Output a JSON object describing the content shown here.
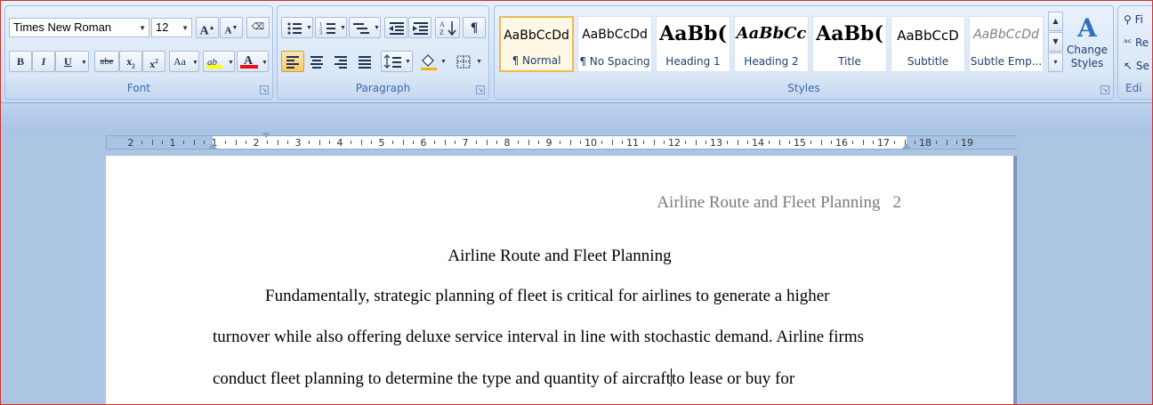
{
  "ribbon": {
    "font_group": {
      "label": "Font",
      "font_name": "Times New Roman",
      "font_size": "12",
      "grow_font": "A",
      "shrink_font": "A",
      "bold": "B",
      "italic": "I",
      "underline": "U",
      "strikethrough": "abe",
      "subscript": "x",
      "superscript": "x",
      "change_case": "Aa",
      "highlight_sample": "ab",
      "font_color_sample": "A",
      "highlight_color": "#ffff00",
      "font_color": "#e81010"
    },
    "paragraph_group": {
      "label": "Paragraph",
      "pilcrow": "¶"
    },
    "styles_group": {
      "label": "Styles",
      "items": [
        {
          "sample": "AaBbCcDd",
          "name": "¶ Normal"
        },
        {
          "sample": "AaBbCcDd",
          "name": "¶ No Spacing"
        },
        {
          "sample": "AaBb(",
          "name": "Heading 1"
        },
        {
          "sample": "AaBbCc",
          "name": "Heading 2"
        },
        {
          "sample": "AaBb(",
          "name": "Title"
        },
        {
          "sample": "AaBbCcD",
          "name": "Subtitle"
        },
        {
          "sample": "AaBbCcDd",
          "name": "Subtle Emp..."
        }
      ],
      "change_styles": "Change Styles"
    },
    "editing_group": {
      "label": "Edi",
      "items": [
        "Fi",
        "Re",
        "Se"
      ]
    }
  },
  "ruler": {
    "labels": [
      "2",
      "1",
      "1",
      "2",
      "3",
      "4",
      "5",
      "6",
      "7",
      "8",
      "9",
      "10",
      "11",
      "12",
      "13",
      "14",
      "15",
      "16",
      "17",
      "18",
      "19"
    ]
  },
  "document": {
    "header_title": "Airline Route and Fleet Planning",
    "page_number": "2",
    "title": "Airline Route and Fleet Planning",
    "line1": "Fundamentally, strategic planning of fleet is critical for airlines to generate a higher",
    "line2": "turnover while also offering deluxe service interval in line with stochastic demand. Airline firms",
    "line3_before_caret": "conduct fleet planning to determine the type and quantity of aircraft",
    "line3_after_caret": "to lease or buy for"
  }
}
